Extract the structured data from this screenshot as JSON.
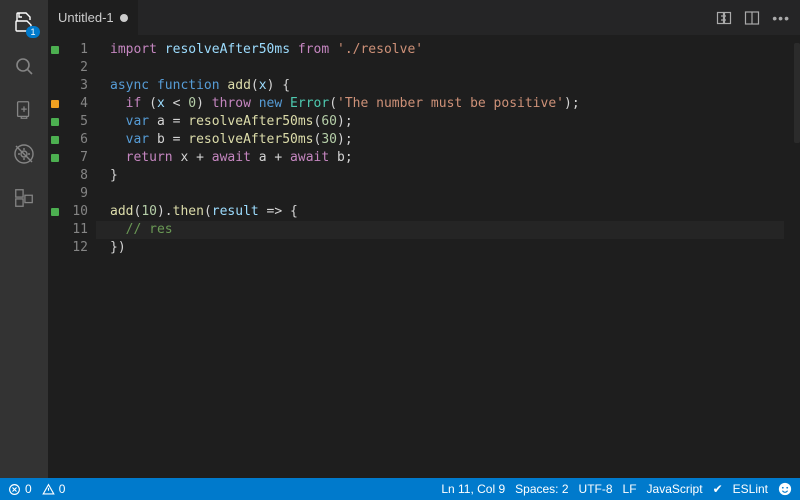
{
  "activity": {
    "explorer_badge": "1"
  },
  "tab": {
    "title": "Untitled-1"
  },
  "code": {
    "line_count": 12,
    "markers": {
      "1": "green",
      "4": "orange",
      "5": "green",
      "6": "green",
      "7": "green",
      "10": "green"
    },
    "lines": {
      "l1": {
        "a": "import",
        "b": " resolveAfter50ms ",
        "c": "from",
        "d": " './resolve'"
      },
      "l3": {
        "a": "async",
        "b": " function ",
        "c": "add",
        "d": "(",
        "e": "x",
        "f": ") {"
      },
      "l4": {
        "a": "  if",
        "b": " (",
        "c": "x",
        "d": " < ",
        "e": "0",
        "f": ") ",
        "g": "throw",
        "h": " new ",
        "i": "Error",
        "j": "(",
        "k": "'The number must be positive'",
        "l": ");"
      },
      "l5": {
        "a": "  var",
        "b": " a = ",
        "c": "resolveAfter50ms",
        "d": "(",
        "e": "60",
        "f": ");"
      },
      "l6": {
        "a": "  var",
        "b": " b = ",
        "c": "resolveAfter50ms",
        "d": "(",
        "e": "30",
        "f": ");"
      },
      "l7": {
        "a": "  return",
        "b": " x + ",
        "c": "await",
        "d": " a + ",
        "e": "await",
        "f": " b;"
      },
      "l8": {
        "a": "}"
      },
      "l10": {
        "a": "add",
        "b": "(",
        "c": "10",
        "d": ").",
        "e": "then",
        "f": "(",
        "g": "result",
        "h": " => {"
      },
      "l11": {
        "a": "  // res"
      },
      "l12": {
        "a": "})"
      }
    }
  },
  "status": {
    "errors": "0",
    "warnings": "0",
    "pos": "Ln 11, Col 9",
    "spaces": "Spaces: 2",
    "encoding": "UTF-8",
    "eol": "LF",
    "lang": "JavaScript",
    "eslint": "ESLint",
    "check": "✔"
  }
}
